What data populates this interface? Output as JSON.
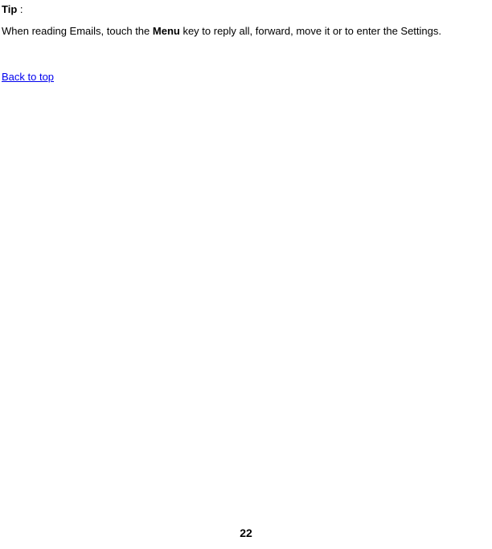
{
  "tip": {
    "label": "Tip",
    "colon": ":"
  },
  "body": {
    "part1": "When reading Emails, touch the ",
    "bold": "Menu",
    "part2": " key to reply all, forward, move it or to enter the Settings."
  },
  "back_link": "Back to top",
  "page_number": "22"
}
